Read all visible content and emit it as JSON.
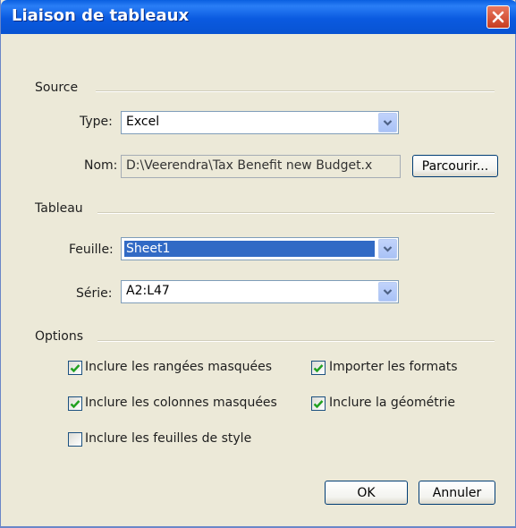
{
  "window": {
    "title": "Liaison de tableaux"
  },
  "source": {
    "group_label": "Source",
    "type_label": "Type:",
    "type_value": "Excel",
    "nom_label": "Nom:",
    "nom_value": "D:\\Veerendra\\Tax Benefit new Budget.x",
    "browse_label": "Parcourir..."
  },
  "tableau": {
    "group_label": "Tableau",
    "sheet_label": "Feuille:",
    "sheet_value": "Sheet1",
    "range_label": "Série:",
    "range_value": "A2:L47"
  },
  "options": {
    "group_label": "Options",
    "items": [
      {
        "label": "Inclure les rangées masquées",
        "checked": true
      },
      {
        "label": "Importer les formats",
        "checked": true
      },
      {
        "label": "Inclure les colonnes masquées",
        "checked": true
      },
      {
        "label": "Inclure la géométrie",
        "checked": true
      },
      {
        "label": "Inclure les feuilles de style",
        "checked": false
      }
    ]
  },
  "buttons": {
    "ok": "OK",
    "cancel": "Annuler"
  },
  "colors": {
    "titlebar": "#0a5fe0",
    "dialog_bg": "#ece9d8",
    "selection": "#316ac5",
    "close": "#c73c20",
    "check": "#21a121"
  },
  "icons": {
    "close": "close-icon",
    "dropdown": "chevron-down-icon",
    "check": "checkmark-icon"
  }
}
